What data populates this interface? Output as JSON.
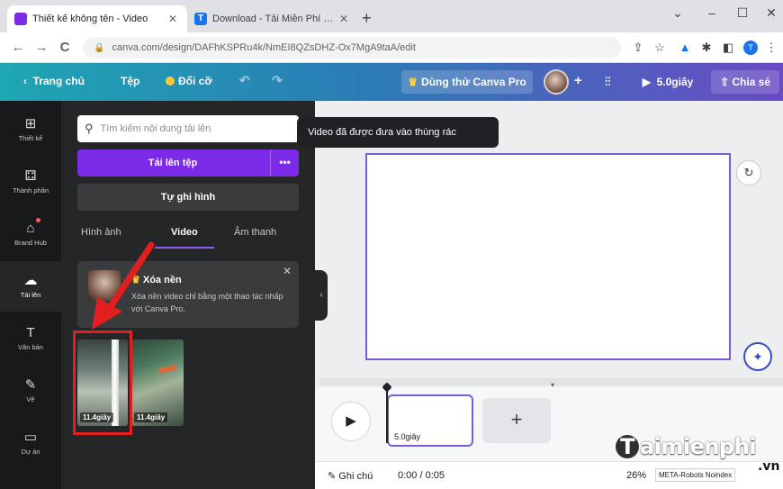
{
  "browser": {
    "tabs": [
      {
        "title": "Thiết kế không tên - Video",
        "active": true,
        "favicon_color": "#7d2ae8"
      },
      {
        "title": "Download - Tải Miễn Phí VN - Ph",
        "active": false,
        "favicon_color": "#1a73e8"
      }
    ],
    "new_tab": "+",
    "window_controls": {
      "collapse": "⌄",
      "minimize": "–",
      "maximize": "☐",
      "close": "✕"
    },
    "nav": {
      "back": "←",
      "forward": "→",
      "reload": "C"
    },
    "url": "canva.com/design/DAFhKSPRu4k/NmEI8QZsDHZ-Ox7MgA9taA/edit",
    "profile_initial": "T"
  },
  "canva_bar": {
    "home": "Trang chủ",
    "file": "Tệp",
    "resize": "Đổi cỡ",
    "try_pro": "Dùng thử Canva Pro",
    "play_duration": "5.0giây",
    "share": "Chia sẻ"
  },
  "rail": {
    "items": [
      {
        "label": "Thiết kế",
        "icon": "⊞"
      },
      {
        "label": "Thành phần",
        "icon": "⚃"
      },
      {
        "label": "Brand Hub",
        "icon": "⌂"
      },
      {
        "label": "Tải lên",
        "icon": "☁"
      },
      {
        "label": "Văn bản",
        "icon": "T"
      },
      {
        "label": "Vẽ",
        "icon": "✎"
      },
      {
        "label": "Dự án",
        "icon": "▭"
      }
    ]
  },
  "panel": {
    "search_placeholder": "Tìm kiếm nội dung tải lên",
    "upload_label": "Tải lên tệp",
    "upload_more": "•••",
    "record_label": "Tự ghi hình",
    "tabs": [
      "Hình ảnh",
      "Video",
      "Âm thanh"
    ],
    "promo": {
      "title": "Xóa nền",
      "description": "Xóa nền video chỉ bằng một thao tác nhấp với Canva Pro.",
      "close": "✕"
    },
    "videos": [
      {
        "duration": "11.4giây"
      },
      {
        "duration": "11.4giây"
      }
    ]
  },
  "workspace": {
    "toast": "Video đã được đưa vào thùng rác",
    "timeline_clip": "5.0giây",
    "add_page": "+",
    "footer": {
      "notes": "Ghi chú",
      "time": "0:00 / 0:05",
      "zoom": "26%",
      "meta": "META-Robots Noindex"
    }
  },
  "watermark": {
    "brand": "aimienphi",
    "initial": "T",
    "suffix": ".vn"
  },
  "colors": {
    "accent": "#7d2ae8",
    "highlight_box": "#e21e1e",
    "arrow": "#e21e1e"
  }
}
